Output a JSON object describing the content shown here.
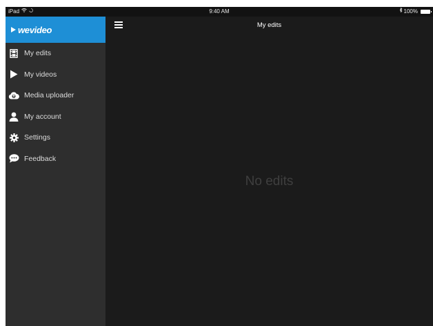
{
  "status_bar": {
    "device": "iPad",
    "time": "9:40 AM",
    "battery": "100%"
  },
  "brand": {
    "name": "wevideo"
  },
  "menu": [
    {
      "label": "My edits",
      "icon": "film-icon"
    },
    {
      "label": "My videos",
      "icon": "play-icon"
    },
    {
      "label": "Media uploader",
      "icon": "cloud-upload-icon"
    },
    {
      "label": "My account",
      "icon": "user-icon"
    },
    {
      "label": "Settings",
      "icon": "gear-icon"
    },
    {
      "label": "Feedback",
      "icon": "chat-bubble-icon"
    }
  ],
  "header": {
    "title": "My edits"
  },
  "main": {
    "empty_message": "No edits"
  },
  "colors": {
    "brand_blue": "#1e8fd6",
    "sidebar_bg": "#2e2e2e",
    "content_bg": "#1b1b1b"
  }
}
